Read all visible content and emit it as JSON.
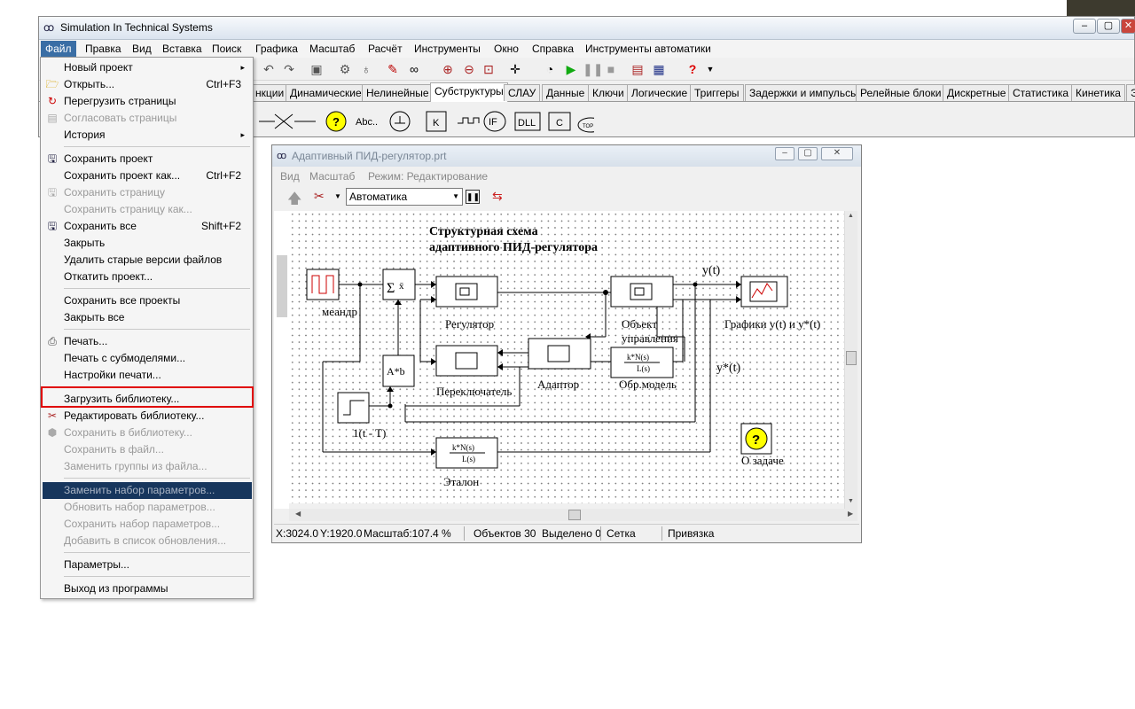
{
  "app": {
    "title": "Simulation In Technical Systems",
    "menus": [
      "Файл",
      "Правка",
      "Вид",
      "Вставка",
      "Поиск",
      "Графика",
      "Масштаб",
      "Расчёт",
      "Инструменты",
      "Окно",
      "Справка",
      "Инструменты автоматики"
    ]
  },
  "tabs": [
    "нкции",
    "Динамические",
    "Нелинейные",
    "Субструктуры",
    "СЛАУ",
    "Данные",
    "Ключи",
    "Логические",
    "Триггеры",
    "Задержки и импульсы",
    "Релейные блоки",
    "Дискретные",
    "Статистика",
    "Кинетика",
    "Э"
  ],
  "selected_tab": "Субструктуры",
  "palette": {
    "text_tool": "Abc..",
    "if_block": "IF",
    "dll_block": "DLL",
    "c_block": "C",
    "k_block": "K",
    "top_block": "TOP"
  },
  "file_menu": {
    "items": [
      {
        "label": "Новый проект",
        "arrow": "▸"
      },
      {
        "label": "Открыть...",
        "shortcut": "Ctrl+F3"
      },
      {
        "label": "Перегрузить страницы"
      },
      {
        "label": "Согласовать страницы"
      },
      {
        "label": "История",
        "arrow": "▸"
      },
      {
        "label": "Сохранить проект"
      },
      {
        "label": "Сохранить проект как...",
        "shortcut": "Ctrl+F2"
      },
      {
        "label": "Сохранить страницу"
      },
      {
        "label": "Сохранить страницу как..."
      },
      {
        "label": "Сохранить все",
        "shortcut": "Shift+F2"
      },
      {
        "label": "Закрыть"
      },
      {
        "label": "Удалить старые версии файлов"
      },
      {
        "label": "Откатить проект..."
      },
      {
        "label": "Сохранить все проекты"
      },
      {
        "label": "Закрыть все"
      },
      {
        "label": "Печать..."
      },
      {
        "label": "Печать с субмоделями..."
      },
      {
        "label": "Настройки печати..."
      },
      {
        "label": "Загрузить библиотеку..."
      },
      {
        "label": "Редактировать библиотеку..."
      },
      {
        "label": "Сохранить в библиотеку..."
      },
      {
        "label": "Сохранить в файл..."
      },
      {
        "label": "Заменить группы из файла..."
      },
      {
        "label": "Заменить набор параметров..."
      },
      {
        "label": "Обновить набор параметров..."
      },
      {
        "label": "Сохранить набор параметров..."
      },
      {
        "label": "Добавить в список обновления..."
      },
      {
        "label": "Параметры..."
      },
      {
        "label": "Выход из программы"
      }
    ]
  },
  "child_window": {
    "title": "Адаптивный ПИД-регулятор.prt",
    "menu": [
      "Вид",
      "Масштаб",
      "Режим: Редактирование"
    ],
    "mode_select": "Автоматика"
  },
  "diagram": {
    "title_line1": "Структурная схема",
    "title_line2": "адаптивного ПИД-регулятора",
    "meander": "меандр",
    "regulator": "Регулятор",
    "object_line1": "Объект",
    "object_line2": "управления",
    "graphs": "Графики y(t) и y*(t)",
    "y": "y(t)",
    "ystar": "y*(t)",
    "switch": "Переключатель",
    "adaptor": "Адаптор",
    "model": "Обр.модель",
    "step": "1(t - T)",
    "reference": "Эталон",
    "about": "О задаче",
    "tf_num": "k*N(s)",
    "tf_den": "L(s)",
    "ab": "A*b",
    "sum": "x̄"
  },
  "status": {
    "x": "X:3024.0",
    "y": "Y:1920.0",
    "scale": "Масштаб:107.4 %",
    "objects": "Объектов 30",
    "selected": "Выделено 0",
    "grid": "Сетка",
    "snap": "Привязка"
  }
}
